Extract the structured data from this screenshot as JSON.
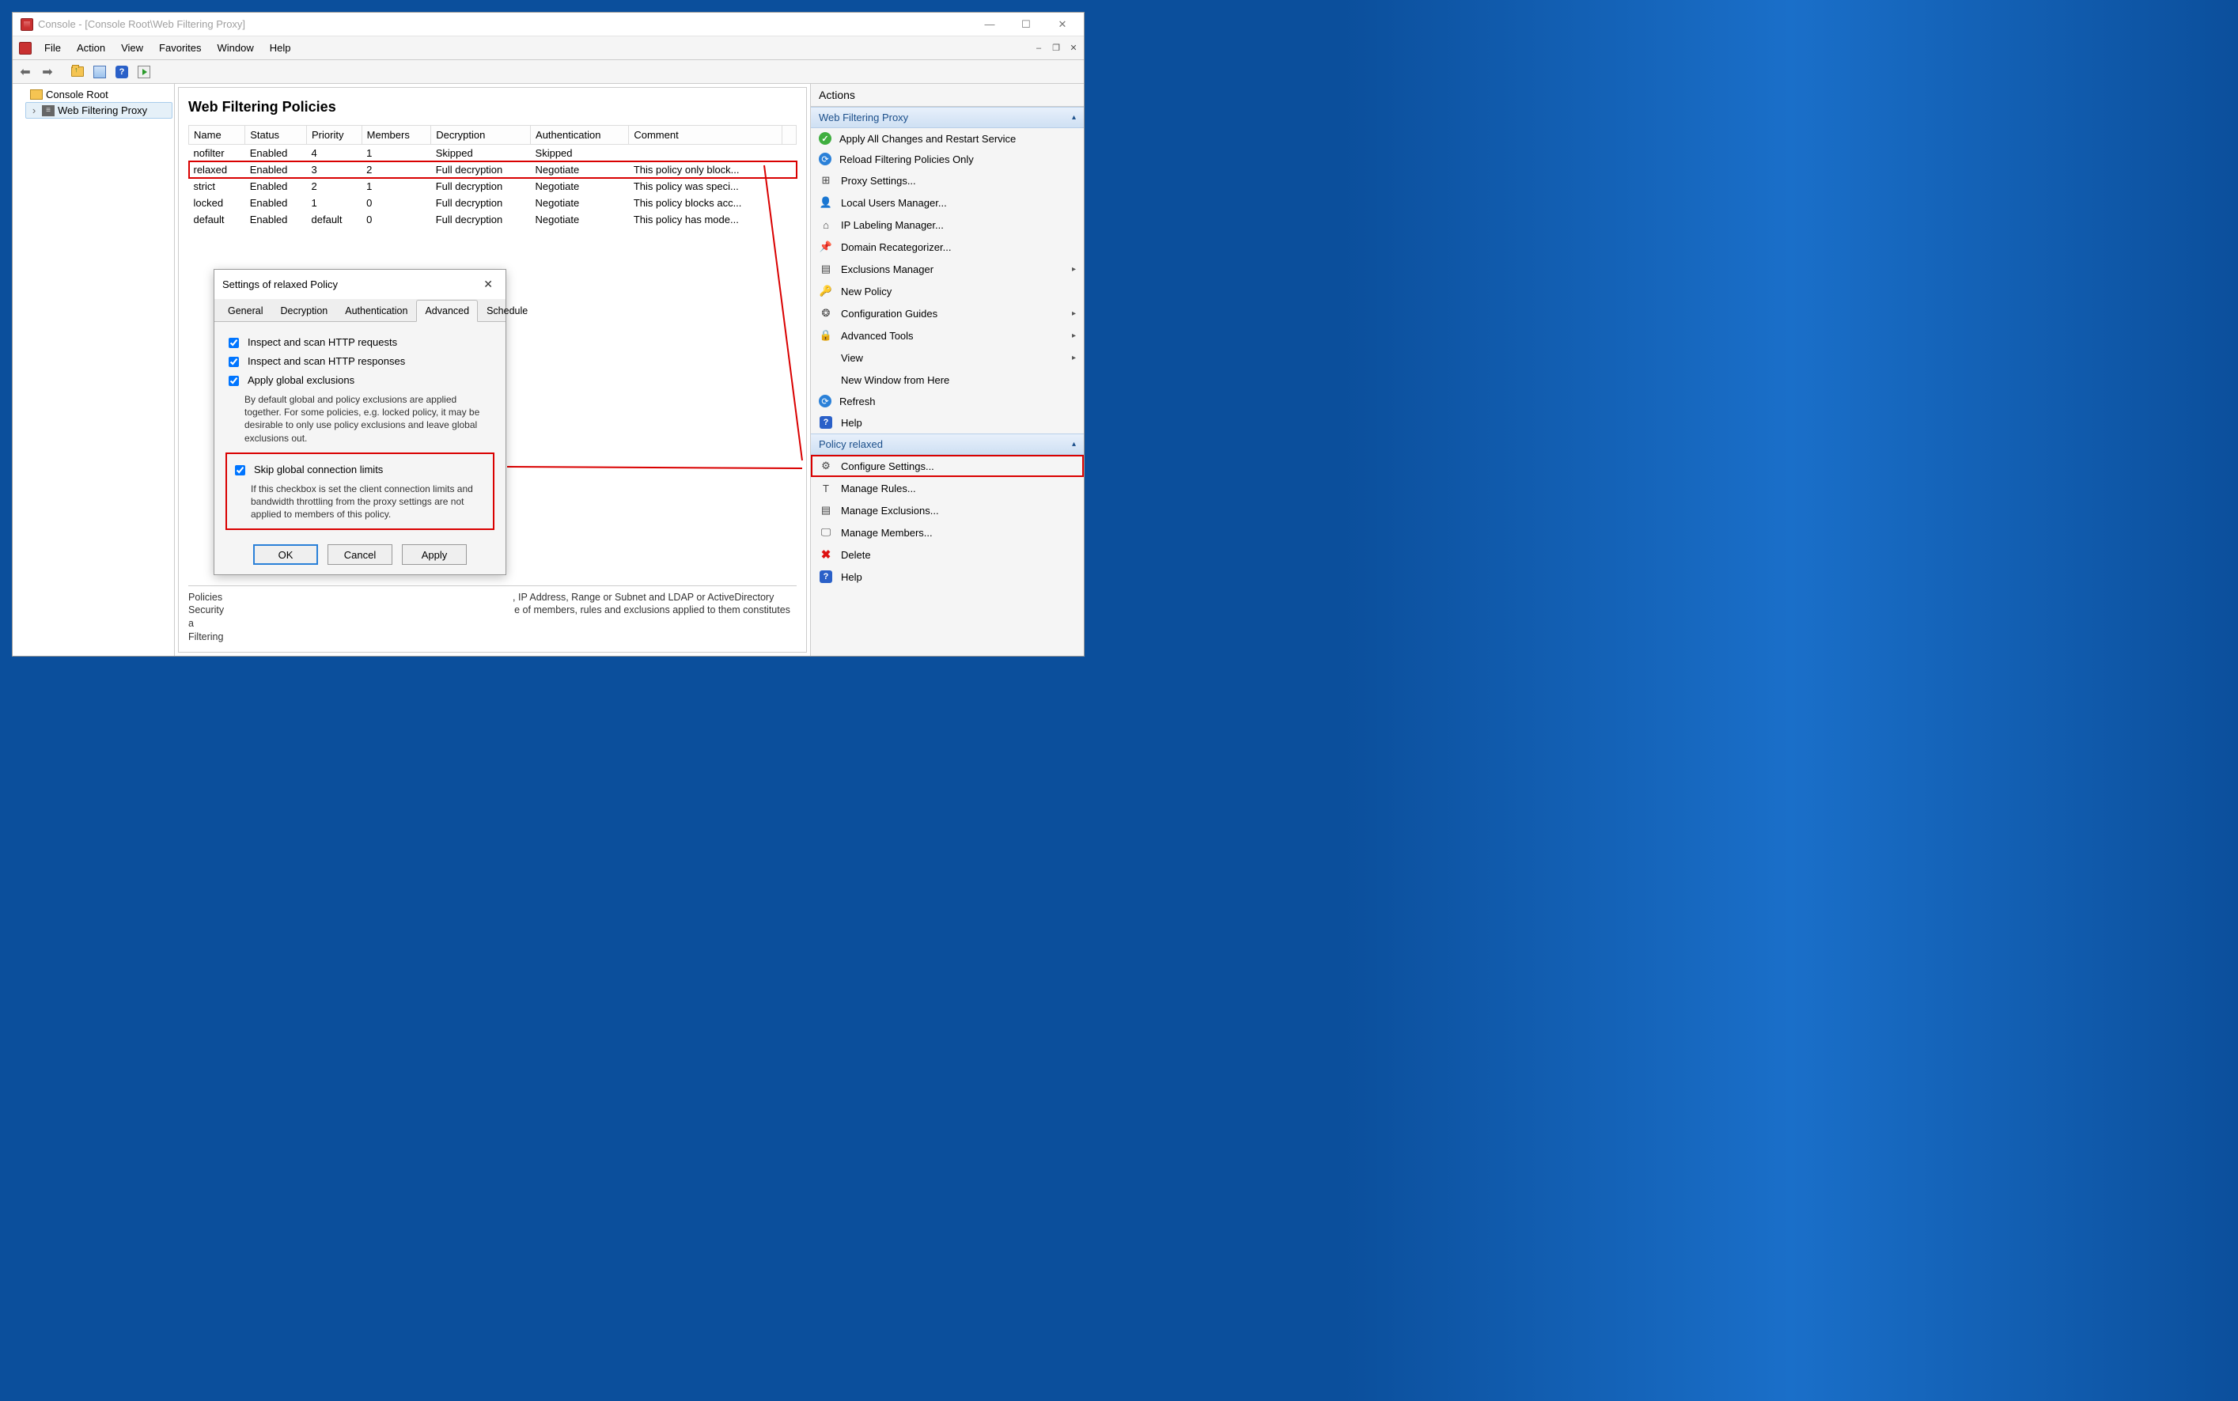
{
  "window": {
    "title": "Console - [Console Root\\Web Filtering Proxy]"
  },
  "menus": [
    "File",
    "Action",
    "View",
    "Favorites",
    "Window",
    "Help"
  ],
  "tree": {
    "root": "Console Root",
    "node": "Web Filtering Proxy"
  },
  "center": {
    "heading": "Web Filtering Policies",
    "columns": [
      "Name",
      "Status",
      "Priority",
      "Members",
      "Decryption",
      "Authentication",
      "Comment"
    ],
    "rows": [
      {
        "name": "nofilter",
        "status": "Enabled",
        "priority": "4",
        "members": "1",
        "decryption": "Skipped",
        "auth": "Skipped",
        "comment": ""
      },
      {
        "name": "relaxed",
        "status": "Enabled",
        "priority": "3",
        "members": "2",
        "decryption": "Full decryption",
        "auth": "Negotiate",
        "comment": "This policy only block..."
      },
      {
        "name": "strict",
        "status": "Enabled",
        "priority": "2",
        "members": "1",
        "decryption": "Full decryption",
        "auth": "Negotiate",
        "comment": "This policy was speci..."
      },
      {
        "name": "locked",
        "status": "Enabled",
        "priority": "1",
        "members": "0",
        "decryption": "Full decryption",
        "auth": "Negotiate",
        "comment": "This policy blocks acc..."
      },
      {
        "name": "default",
        "status": "Enabled",
        "priority": "default",
        "members": "0",
        "decryption": "Full decryption",
        "auth": "Negotiate",
        "comment": "This policy has mode..."
      }
    ],
    "description_prefix": "Policies",
    "description_mid": ", IP Address, Range or Subnet and LDAP or ActiveDirectory",
    "description_line2a": "Security",
    "description_line2b": "e of members, rules and exclusions applied to them constitutes a",
    "description_line3": "Filtering"
  },
  "actions": {
    "title": "Actions",
    "group1": "Web Filtering Proxy",
    "items1": [
      {
        "icon": "green-check",
        "label": "Apply All Changes and Restart Service"
      },
      {
        "icon": "blue-reload",
        "label": "Reload Filtering Policies Only"
      },
      {
        "icon": "mono",
        "glyph": "⊞",
        "label": "Proxy Settings..."
      },
      {
        "icon": "mono",
        "glyph": "👤",
        "label": "Local Users Manager..."
      },
      {
        "icon": "mono",
        "glyph": "⌂",
        "label": "IP Labeling Manager..."
      },
      {
        "icon": "mono",
        "glyph": "📌",
        "label": "Domain Recategorizer..."
      },
      {
        "icon": "mono",
        "glyph": "▤",
        "label": "Exclusions Manager",
        "sub": true
      },
      {
        "icon": "mono",
        "glyph": "🔑",
        "label": "New Policy"
      },
      {
        "icon": "mono",
        "glyph": "❂",
        "label": "Configuration Guides",
        "sub": true
      },
      {
        "icon": "lock",
        "glyph": "🔒",
        "label": "Advanced Tools",
        "sub": true
      },
      {
        "icon": "none",
        "glyph": "",
        "label": "View",
        "sub": true
      },
      {
        "icon": "none",
        "glyph": "",
        "label": "New Window from Here"
      },
      {
        "icon": "blue-reload",
        "glyph": "",
        "label": "Refresh"
      },
      {
        "icon": "help",
        "glyph": "?",
        "label": "Help"
      }
    ],
    "group2": "Policy relaxed",
    "items2": [
      {
        "icon": "mono",
        "glyph": "⚙",
        "label": "Configure Settings...",
        "hl": true
      },
      {
        "icon": "mono",
        "glyph": "T",
        "label": "Manage Rules..."
      },
      {
        "icon": "mono",
        "glyph": "▤",
        "label": "Manage Exclusions..."
      },
      {
        "icon": "mono",
        "glyph": "🖵",
        "label": "Manage Members..."
      },
      {
        "icon": "red-x",
        "glyph": "✖",
        "label": "Delete"
      },
      {
        "icon": "help",
        "glyph": "?",
        "label": "Help"
      }
    ]
  },
  "dialog": {
    "title": "Settings of relaxed Policy",
    "tabs": [
      "General",
      "Decryption",
      "Authentication",
      "Advanced",
      "Schedule"
    ],
    "active_tab": "Advanced",
    "chk1": "Inspect and scan HTTP requests",
    "chk2": "Inspect and scan HTTP responses",
    "chk3": "Apply global exclusions",
    "hint3": "By default global and policy exclusions are applied together. For some policies, e.g. locked policy, it may be desirable to only use policy exclusions and leave global exclusions out.",
    "chk4": "Skip global connection limits",
    "hint4": "If this checkbox is set the client connection limits and bandwidth throttling from the proxy settings are not applied to members of this policy.",
    "ok": "OK",
    "cancel": "Cancel",
    "apply": "Apply"
  }
}
